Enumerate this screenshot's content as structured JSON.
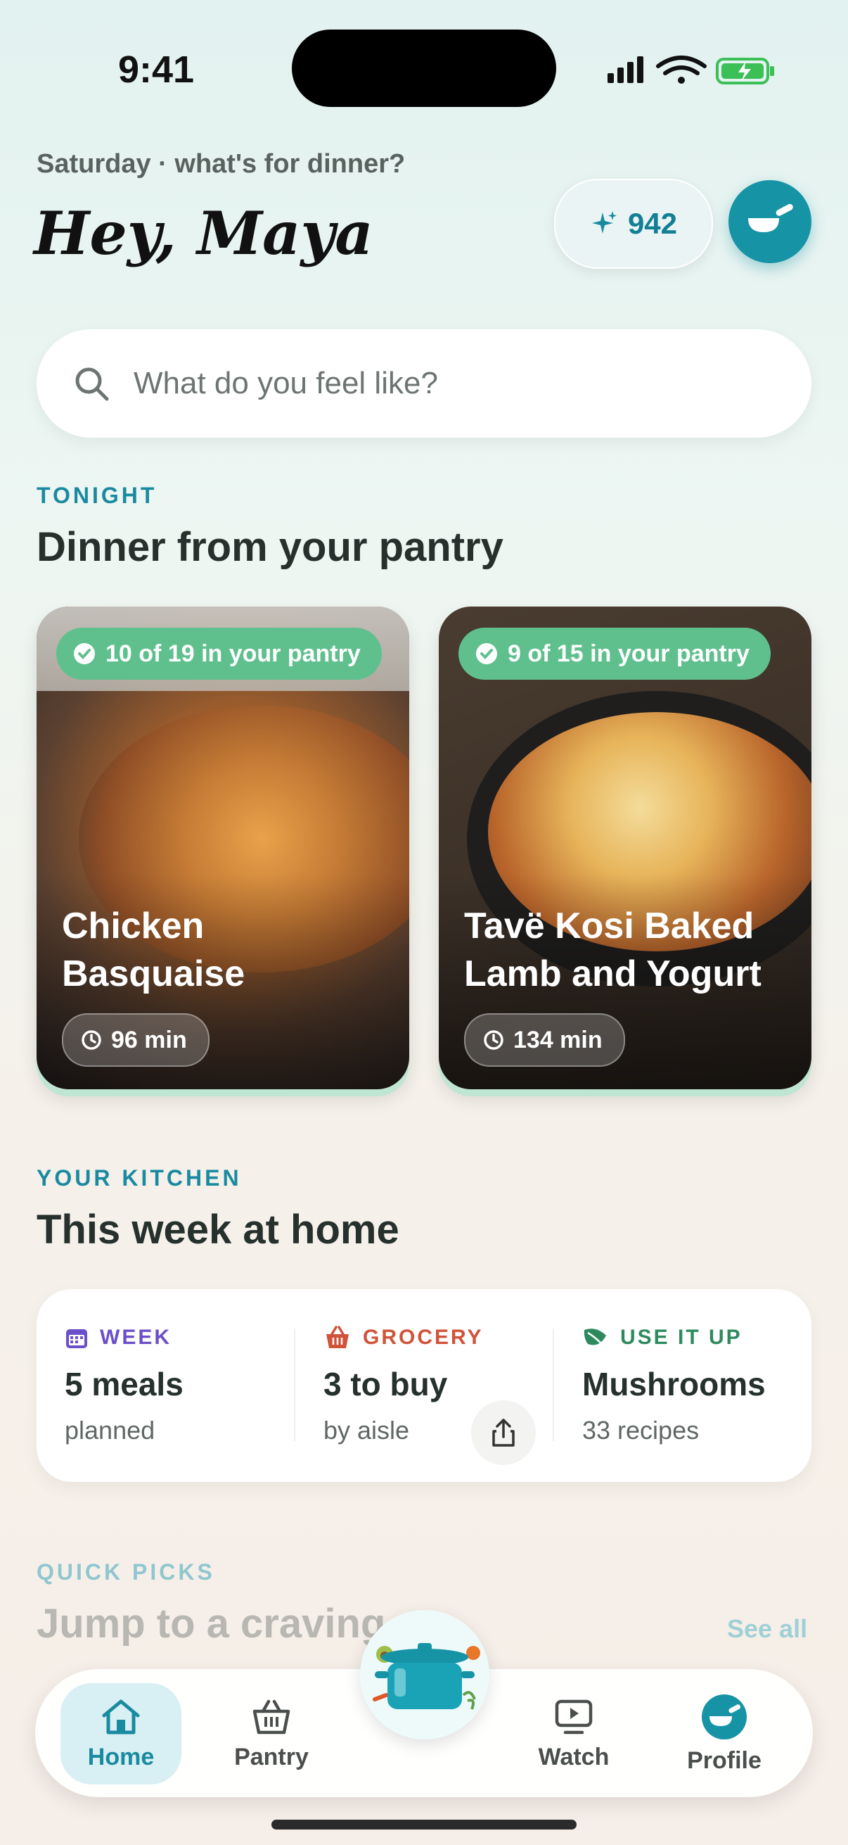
{
  "status": {
    "time": "9:41"
  },
  "header": {
    "subtitle": "Saturday · what's for dinner?",
    "greeting": "Hey, Maya",
    "points": "942"
  },
  "search": {
    "placeholder": "What do you feel like?"
  },
  "tonight": {
    "eyebrow": "TONIGHT",
    "title": "Dinner from your pantry",
    "cards": [
      {
        "pantry": "10 of 19 in your pantry",
        "name": "Chicken Basquaise",
        "time": "96 min"
      },
      {
        "pantry": "9 of 15 in your pantry",
        "name": "Tavë Kosi Baked Lamb and Yogurt",
        "time": "134 min"
      }
    ]
  },
  "kitchen": {
    "eyebrow": "YOUR KITCHEN",
    "title": "This week at home",
    "week": {
      "label": "WEEK",
      "value": "5 meals",
      "sub": "planned"
    },
    "grocery": {
      "label": "GROCERY",
      "value": "3 to buy",
      "sub": "by aisle"
    },
    "useitup": {
      "label": "USE IT UP",
      "value": "Mushrooms",
      "sub": "33 recipes"
    }
  },
  "quickpicks": {
    "eyebrow": "QUICK PICKS",
    "title": "Jump to a craving",
    "see_all": "See all"
  },
  "tabs": {
    "home": "Home",
    "pantry": "Pantry",
    "watch": "Watch",
    "profile": "Profile"
  },
  "colors": {
    "accent": "#1a8aa0",
    "pantry_pill": "#5fc08e",
    "week": "#6b4fc9",
    "grocery": "#d0533a",
    "useitup": "#2e8a5e"
  },
  "icons": [
    "signal-icon",
    "wifi-icon",
    "battery-icon",
    "sparkle-icon",
    "pan-icon",
    "search-icon",
    "check-icon",
    "timer-icon",
    "calendar-icon",
    "basket-icon",
    "leaf-icon",
    "share-icon",
    "home-icon",
    "pot-icon",
    "play-icon"
  ]
}
